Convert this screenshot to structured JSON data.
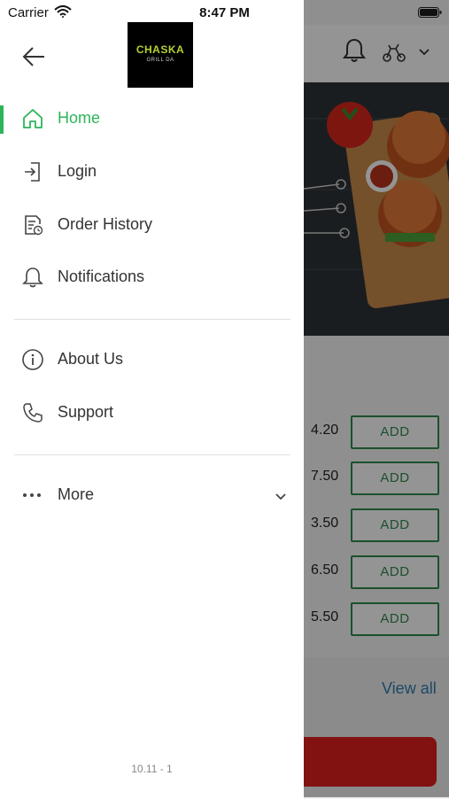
{
  "status_bar": {
    "carrier": "Carrier",
    "time": "8:47 PM"
  },
  "drawer": {
    "logo": {
      "name": "CHASKA",
      "tagline": "GRILL DA"
    },
    "menu": [
      {
        "label": "Home",
        "icon": "home-icon",
        "active": true
      },
      {
        "label": "Login",
        "icon": "login-icon"
      },
      {
        "label": "Order History",
        "icon": "order-history-icon"
      },
      {
        "label": "Notifications",
        "icon": "bell-icon"
      },
      {
        "label": "About Us",
        "icon": "info-icon"
      },
      {
        "label": "Support",
        "icon": "phone-icon"
      },
      {
        "label": "More",
        "icon": "more-icon"
      }
    ],
    "version": "10.11 - 1"
  },
  "background": {
    "items": [
      {
        "price": "4.20",
        "action": "ADD"
      },
      {
        "price": "7.50",
        "action": "ADD"
      },
      {
        "price": "3.50",
        "action": "ADD"
      },
      {
        "price": "6.50",
        "action": "ADD"
      },
      {
        "price": "5.50",
        "action": "ADD"
      }
    ],
    "view_all": "View all"
  },
  "colors": {
    "accent": "#2db45a",
    "add_border": "#2f8a4c",
    "link": "#2f7db0",
    "cta": "#e02020"
  }
}
